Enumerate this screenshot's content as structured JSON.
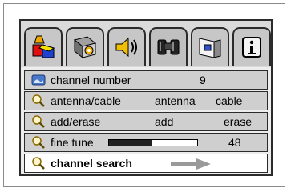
{
  "menu": {
    "tabs": [
      {
        "icon": "shapes-icon",
        "active": false
      },
      {
        "icon": "settings-icon",
        "active": false
      },
      {
        "icon": "speaker-icon",
        "active": false
      },
      {
        "icon": "binoculars-icon",
        "active": true
      },
      {
        "icon": "window-icon",
        "active": false
      },
      {
        "icon": "info-icon",
        "active": false
      }
    ],
    "rows": {
      "channel_number": {
        "icon": "tv-icon",
        "label": "channel number",
        "value": "9"
      },
      "antenna_cable": {
        "icon": "magnifier-icon",
        "label": "antenna/cable",
        "option1": "antenna",
        "option2": "cable"
      },
      "add_erase": {
        "icon": "magnifier-icon",
        "label": "add/erase",
        "option1": "add",
        "option2": "erase"
      },
      "fine_tune": {
        "icon": "magnifier-icon",
        "label": "fine tune",
        "value": "48",
        "level": 0.48
      },
      "channel_search": {
        "icon": "magnifier-icon",
        "label": "channel search",
        "selected": true
      }
    }
  },
  "colors": {
    "panel_border": "#2b2b2b",
    "row_fill": "#cfcfcf",
    "tab_fill": "#c7c7c7",
    "active_tab_fill": "#c0c0c0",
    "arrow": "#9a9a9a"
  }
}
